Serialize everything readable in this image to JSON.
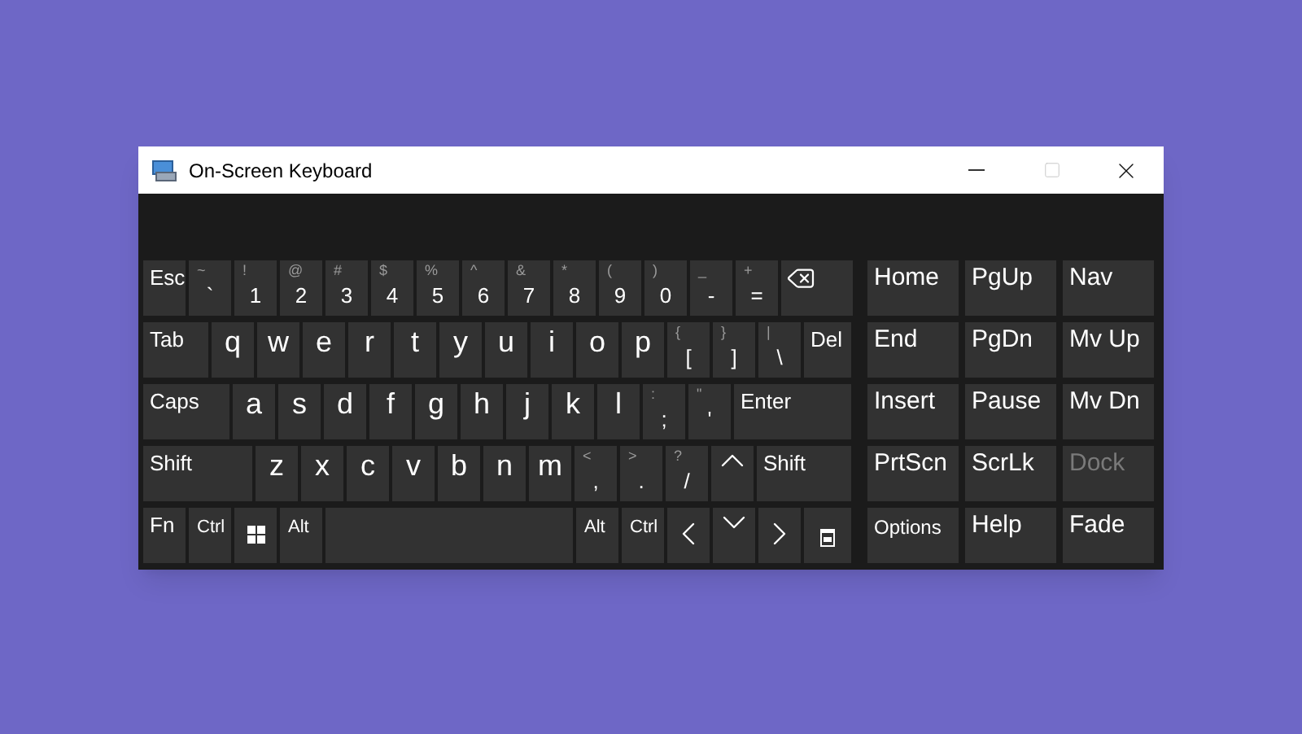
{
  "window": {
    "title": "On-Screen Keyboard"
  },
  "main_rows": [
    {
      "keys": [
        {
          "kind": "function",
          "label": "Esc"
        },
        {
          "kind": "symbol",
          "shift": "~",
          "label": "`"
        },
        {
          "kind": "symbol",
          "shift": "!",
          "label": "1"
        },
        {
          "kind": "symbol",
          "shift": "@",
          "label": "2"
        },
        {
          "kind": "symbol",
          "shift": "#",
          "label": "3"
        },
        {
          "kind": "symbol",
          "shift": "$",
          "label": "4"
        },
        {
          "kind": "symbol",
          "shift": "%",
          "label": "5"
        },
        {
          "kind": "symbol",
          "shift": "^",
          "label": "6"
        },
        {
          "kind": "symbol",
          "shift": "&",
          "label": "7"
        },
        {
          "kind": "symbol",
          "shift": "*",
          "label": "8"
        },
        {
          "kind": "symbol",
          "shift": "(",
          "label": "9"
        },
        {
          "kind": "symbol",
          "shift": ")",
          "label": "0"
        },
        {
          "kind": "symbol",
          "shift": "_",
          "label": "-"
        },
        {
          "kind": "symbol",
          "shift": "+",
          "label": "="
        },
        {
          "kind": "backspace"
        }
      ]
    },
    {
      "keys": [
        {
          "kind": "function",
          "label": "Tab"
        },
        {
          "kind": "letter",
          "label": "q"
        },
        {
          "kind": "letter",
          "label": "w"
        },
        {
          "kind": "letter",
          "label": "e"
        },
        {
          "kind": "letter",
          "label": "r"
        },
        {
          "kind": "letter",
          "label": "t"
        },
        {
          "kind": "letter",
          "label": "y"
        },
        {
          "kind": "letter",
          "label": "u"
        },
        {
          "kind": "letter",
          "label": "i"
        },
        {
          "kind": "letter",
          "label": "o"
        },
        {
          "kind": "letter",
          "label": "p"
        },
        {
          "kind": "symbol",
          "shift": "{",
          "label": "["
        },
        {
          "kind": "symbol",
          "shift": "}",
          "label": "]"
        },
        {
          "kind": "symbol",
          "shift": "|",
          "label": "\\"
        },
        {
          "kind": "function",
          "label": "Del"
        }
      ]
    },
    {
      "keys": [
        {
          "kind": "function",
          "label": "Caps"
        },
        {
          "kind": "letter",
          "label": "a"
        },
        {
          "kind": "letter",
          "label": "s"
        },
        {
          "kind": "letter",
          "label": "d"
        },
        {
          "kind": "letter",
          "label": "f"
        },
        {
          "kind": "letter",
          "label": "g"
        },
        {
          "kind": "letter",
          "label": "h"
        },
        {
          "kind": "letter",
          "label": "j"
        },
        {
          "kind": "letter",
          "label": "k"
        },
        {
          "kind": "letter",
          "label": "l"
        },
        {
          "kind": "symbol",
          "shift": ":",
          "label": ";"
        },
        {
          "kind": "symbol",
          "shift": "\"",
          "label": "'"
        },
        {
          "kind": "function",
          "label": "Enter"
        }
      ]
    },
    {
      "keys": [
        {
          "kind": "function",
          "label": "Shift"
        },
        {
          "kind": "letter",
          "label": "z"
        },
        {
          "kind": "letter",
          "label": "x"
        },
        {
          "kind": "letter",
          "label": "c"
        },
        {
          "kind": "letter",
          "label": "v"
        },
        {
          "kind": "letter",
          "label": "b"
        },
        {
          "kind": "letter",
          "label": "n"
        },
        {
          "kind": "letter",
          "label": "m"
        },
        {
          "kind": "symbol",
          "shift": "<",
          "label": ","
        },
        {
          "kind": "symbol",
          "shift": ">",
          "label": "."
        },
        {
          "kind": "symbol",
          "shift": "?",
          "label": "/"
        },
        {
          "kind": "up"
        },
        {
          "kind": "function",
          "label": "Shift"
        }
      ]
    },
    {
      "keys": [
        {
          "kind": "function",
          "label": "Fn"
        },
        {
          "kind": "small",
          "label": "Ctrl"
        },
        {
          "kind": "windows"
        },
        {
          "kind": "small",
          "label": "Alt"
        },
        {
          "kind": "space"
        },
        {
          "kind": "small",
          "label": "Alt"
        },
        {
          "kind": "small",
          "label": "Ctrl"
        },
        {
          "kind": "left"
        },
        {
          "kind": "down"
        },
        {
          "kind": "right"
        },
        {
          "kind": "menu"
        }
      ]
    }
  ],
  "side_rows": [
    {
      "keys": [
        {
          "label": "Home",
          "disabled": false
        },
        {
          "label": "PgUp",
          "disabled": false
        },
        {
          "label": "Nav",
          "disabled": false
        }
      ]
    },
    {
      "keys": [
        {
          "label": "End",
          "disabled": false
        },
        {
          "label": "PgDn",
          "disabled": false
        },
        {
          "label": "Mv Up",
          "disabled": false
        }
      ]
    },
    {
      "keys": [
        {
          "label": "Insert",
          "disabled": false
        },
        {
          "label": "Pause",
          "disabled": false
        },
        {
          "label": "Mv Dn",
          "disabled": false
        }
      ]
    },
    {
      "keys": [
        {
          "label": "PrtScn",
          "disabled": false
        },
        {
          "label": "ScrLk",
          "disabled": false
        },
        {
          "label": "Dock",
          "disabled": true
        }
      ]
    },
    {
      "keys": [
        {
          "label": "Options",
          "disabled": false,
          "small": true
        },
        {
          "label": "Help",
          "disabled": false
        },
        {
          "label": "Fade",
          "disabled": false
        }
      ]
    }
  ]
}
